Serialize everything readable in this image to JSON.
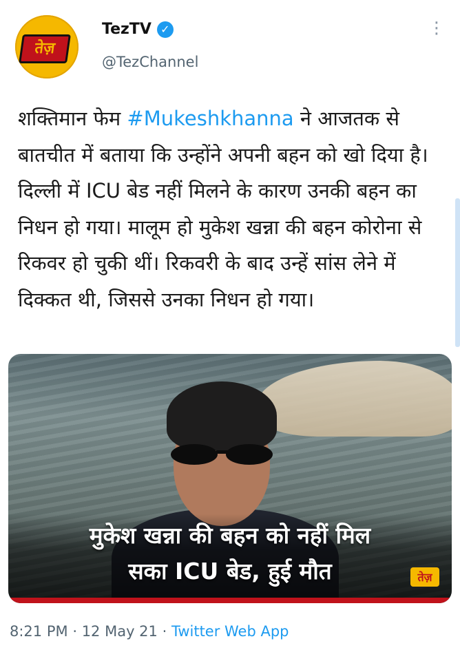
{
  "account": {
    "logo_text": "तेज़",
    "name": "TezTV",
    "verified_mark": "✓",
    "handle": "@TezChannel",
    "more_icon": "⋮"
  },
  "tweet": {
    "text_before": "शक्तिमान फेम ",
    "hashtag": "#Mukeshkhanna",
    "text_after": " ने आजतक से बातचीत में बताया कि उन्होंने अपनी बहन को खो दिया है। दिल्ली में ICU बेड नहीं मिलने के कारण उनकी बहन का निधन हो गया। मालूम हो मुकेश खन्ना की बहन कोरोना से रिकवर हो चुकी थीं। रिकवरी के बाद उन्हें सांस लेने में दिक्कत थी, जिससे उनका निधन हो गया।"
  },
  "media": {
    "caption_line1": "मुकेश खन्ना की बहन को नहीं मिल",
    "caption_line2": "सका ICU बेड, हुई मौत",
    "logo_text": "तेज़"
  },
  "footer": {
    "time": "8:21 PM",
    "separator": "·",
    "date": "12 May 21",
    "app": "Twitter Web App"
  },
  "colors": {
    "link": "#1d9bf0",
    "brand_red": "#c0121b",
    "brand_yellow": "#f5b800"
  }
}
